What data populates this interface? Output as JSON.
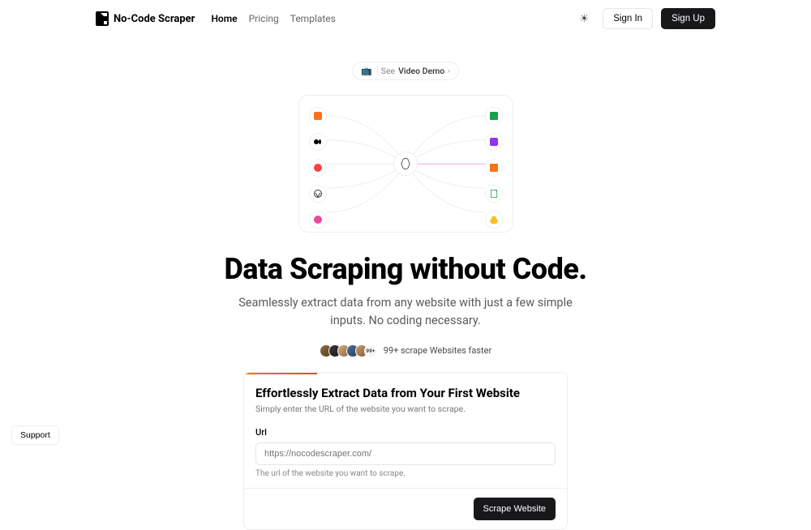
{
  "header": {
    "logo_text": "No-Code Scraper",
    "nav": {
      "home": "Home",
      "pricing": "Pricing",
      "templates": "Templates"
    },
    "sign_in": "Sign In",
    "sign_up": "Sign Up"
  },
  "video_demo": {
    "see": "See",
    "label": "Video Demo"
  },
  "diagram": {
    "left_icons": [
      "blogger-icon",
      "medium-icon",
      "producthunt-icon",
      "wordpress-icon",
      "dribbble-icon"
    ],
    "right_icons": [
      "excel-icon",
      "database-icon",
      "table-icon",
      "pdf-icon",
      "drive-icon"
    ]
  },
  "hero": {
    "title": "Data Scraping without Code.",
    "subtitle": "Seamlessly extract data from any website with just a few simple inputs. No coding necessary."
  },
  "social": {
    "more": "99+",
    "text": "99+ scrape Websites faster"
  },
  "card": {
    "title": "Effortlessly Extract Data from Your First Website",
    "subtitle": "Simply enter the URL of the website you want to scrape.",
    "url_label": "Url",
    "url_placeholder": "https://nocodescraper.com/",
    "url_help": "The url of the website you want to scrape.",
    "scrape_button": "Scrape Website"
  },
  "support": "Support"
}
